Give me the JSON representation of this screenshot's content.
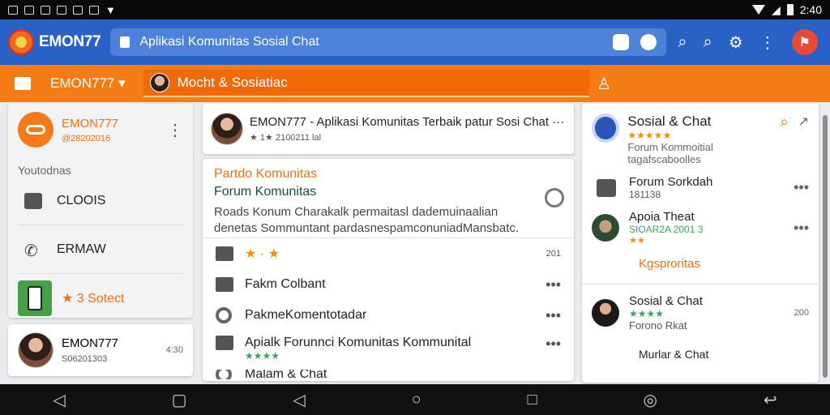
{
  "status": {
    "time": "2:40"
  },
  "app": {
    "brand": "EMON77",
    "url": "Aplikasi Komunitas Sosial Chat"
  },
  "nav": {
    "brand": "EMON777",
    "search": "Mocht & Sosiatiac",
    "person_icon": "person-icon"
  },
  "left": {
    "profile_name": "EMON777",
    "profile_id": "@28202016",
    "section": "Youtodnas",
    "items": [
      "CLOOIS",
      "ERMAW",
      "★ 3 Sotect"
    ],
    "user2_name": "EMON777",
    "user2_id": "S06201303",
    "user2_time": "4:30"
  },
  "middle": {
    "top_title": "EMON777 - Aplikasi Komunitas Terbaik patur Sosi Chat ···",
    "top_sub": "★ 1★ 2100211 lal",
    "card_title": "Partdo Komunitas",
    "card_subtitle": "Forum Komunitas",
    "card_body_1": "Roads Konum Charakalk permaitasl dademuinaalian",
    "card_body_2": "denetas Sommuntant pardasnespamconuniadMansbatc.",
    "row1": "★ · ★",
    "row1_time": "201",
    "row2": "Fakm Colbant",
    "row3": "PakmeKomentotadar",
    "row4": "Apialk Forunnci Komunitas Kommunital",
    "row4_stars": "★★★★",
    "row5": "Malam & Chat"
  },
  "right": {
    "header_title": "Sosial & Chat",
    "header_stars": "★★★★★",
    "header_sub": "Forum Kommoitial tagafscaboolles",
    "r1_title": "Forum Sorkdah",
    "r1_sub": "181138",
    "r2_title": "Apoia Theat",
    "r2_sub": "SIOAR2A 2001 3",
    "r2_stars": "★★",
    "link": "Kgsproritas",
    "r3_title": "Sosial & Chat",
    "r3_stars": "★★★★",
    "r3_sub": "Forono Rkat",
    "r3_time": "200",
    "r4_title": "Murlar & Chat"
  },
  "icons": {
    "lock": "lock-icon",
    "search": "search-icon",
    "settings": "gear-icon",
    "more": "more-icon",
    "back": "back-icon",
    "home": "home-icon",
    "recents": "recents-icon"
  }
}
